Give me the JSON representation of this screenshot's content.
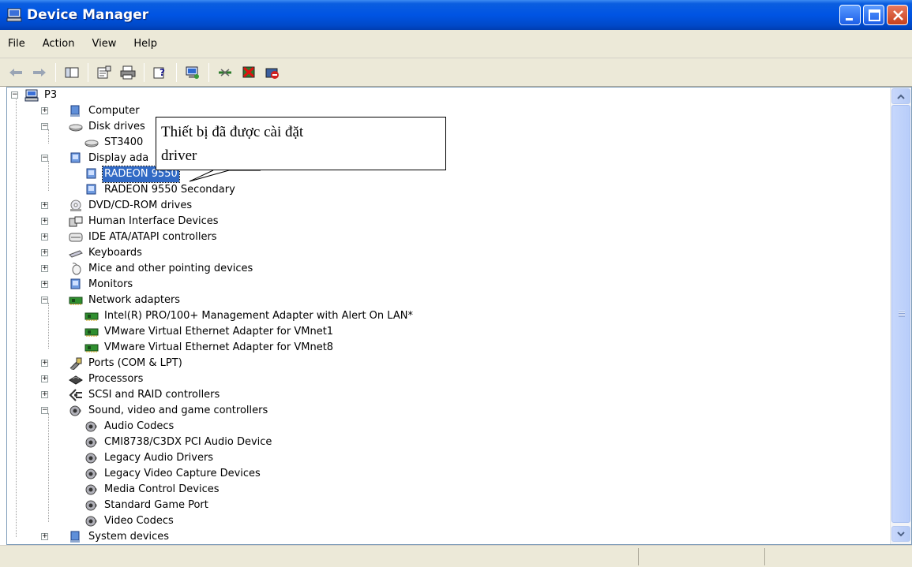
{
  "window": {
    "title": "Device Manager",
    "icon": "computer-monitor-icon"
  },
  "menu": {
    "items": [
      "File",
      "Action",
      "View",
      "Help"
    ]
  },
  "toolbar": {
    "buttons": [
      "back-arrow-icon",
      "forward-arrow-icon",
      "show-hide-console-tree-icon",
      "properties-icon",
      "print-icon",
      "help-icon",
      "scan-hardware-icon",
      "update-driver-icon",
      "uninstall-icon",
      "disable-icon"
    ]
  },
  "tree": {
    "root": "P3",
    "computer": "Computer",
    "disk_drives": "Disk drives",
    "disk_child": "ST3400",
    "display_adapters": "Display ada",
    "display_child_1": "RADEON 9550",
    "display_child_2": "RADEON 9550 Secondary",
    "dvd": "DVD/CD-ROM drives",
    "hid": "Human Interface Devices",
    "ide": "IDE ATA/ATAPI controllers",
    "keyboards": "Keyboards",
    "mice": "Mice and other pointing devices",
    "monitors": "Monitors",
    "network": "Network adapters",
    "net_child_1": "Intel(R) PRO/100+ Management Adapter with Alert On LAN*",
    "net_child_2": "VMware Virtual Ethernet Adapter for VMnet1",
    "net_child_3": "VMware Virtual Ethernet Adapter for VMnet8",
    "ports": "Ports (COM & LPT)",
    "processors": "Processors",
    "scsi": "SCSI and RAID controllers",
    "sound": "Sound, video and game controllers",
    "sound_child_1": "Audio Codecs",
    "sound_child_2": "CMI8738/C3DX PCI Audio Device",
    "sound_child_3": "Legacy Audio Drivers",
    "sound_child_4": "Legacy Video Capture Devices",
    "sound_child_5": "Media Control Devices",
    "sound_child_6": "Standard Game Port",
    "sound_child_7": "Video Codecs",
    "system": "System devices"
  },
  "callout": {
    "line1": "Thiết bị đã được cài đặt",
    "line2": "driver"
  },
  "colors": {
    "titlebar": "#0054e3",
    "selection": "#316ac5",
    "chrome": "#ece9d8"
  }
}
